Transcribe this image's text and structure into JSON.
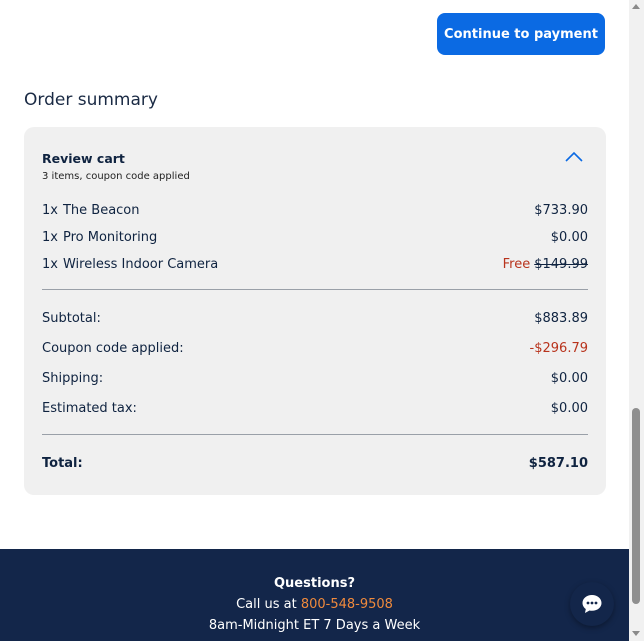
{
  "cta": {
    "label": "Continue to payment"
  },
  "summary": {
    "title": "Order summary",
    "review_title": "Review cart",
    "review_subtitle": "3 items, coupon code applied",
    "items": [
      {
        "qty": "1x",
        "name": "The Beacon",
        "price": "$733.90"
      },
      {
        "qty": "1x",
        "name": "Pro Monitoring",
        "price": "$0.00"
      },
      {
        "qty": "1x",
        "name": "Wireless Indoor Camera",
        "free_label": "Free",
        "original_price": "$149.99"
      }
    ],
    "subtotal": {
      "label": "Subtotal:",
      "value": "$883.89"
    },
    "coupon": {
      "label": "Coupon code applied:",
      "value": "-$296.79"
    },
    "shipping": {
      "label": "Shipping:",
      "value": "$0.00"
    },
    "tax": {
      "label": "Estimated tax:",
      "value": "$0.00"
    },
    "total": {
      "label": "Total:",
      "value": "$587.10"
    }
  },
  "footer": {
    "heading": "Questions?",
    "call_prefix": "Call us at ",
    "phone": "800-548-9508",
    "hours": "8am-Midnight ET 7 Days a Week"
  },
  "icons": {
    "collapse": "chevron-up-icon",
    "chat": "chat-bubble-icon"
  },
  "colors": {
    "primary_button": "#0b6ae3",
    "footer_bg": "#13264a",
    "discount": "#b8331c",
    "phone_link": "#f08a3c",
    "card_bg": "#f0f0f0"
  }
}
